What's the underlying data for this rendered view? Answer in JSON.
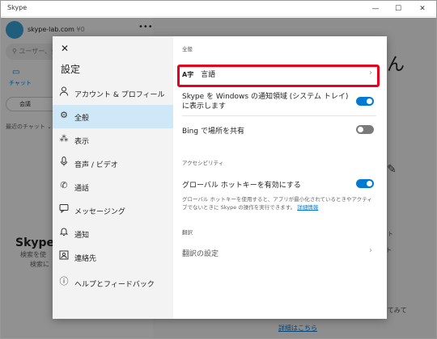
{
  "window": {
    "title": "Skype",
    "minimize": "—",
    "maximize": "☐",
    "close": "✕"
  },
  "background": {
    "avatar_text": "",
    "account": "skype-lab.com",
    "account_suffix": "¥0",
    "more": "•••",
    "search_placeholder": "ユーザー、グル…",
    "chat_label": "チャット",
    "meet_label": "会議",
    "recent_label": "最近のチャット ⌄",
    "big_text": "Skype で",
    "sub1": "検索を使",
    "sub2": "検索に",
    "right_big": "さん",
    "pencil": "✎",
    "r1": "ト",
    "r2": "ト",
    "r3": "試してみて",
    "r4": "詳細はこちら"
  },
  "settings": {
    "close": "✕",
    "title": "設定",
    "nav": [
      {
        "icon": "person-icon",
        "glyph": "⚲",
        "label": "アカウント & プロフィール",
        "selected": false
      },
      {
        "icon": "gear-icon",
        "glyph": "⚙",
        "label": "全般",
        "selected": true
      },
      {
        "icon": "wand-icon",
        "glyph": "✎",
        "label": "表示",
        "selected": false
      },
      {
        "icon": "microphone-icon",
        "glyph": "🎙",
        "label": "音声 / ビデオ",
        "selected": false
      },
      {
        "icon": "phone-icon",
        "glyph": "✆",
        "label": "通話",
        "selected": false
      },
      {
        "icon": "message-icon",
        "glyph": "▭",
        "label": "メッセージング",
        "selected": false
      },
      {
        "icon": "bell-icon",
        "glyph": "♫",
        "label": "通知",
        "selected": false
      },
      {
        "icon": "contacts-icon",
        "glyph": "☺",
        "label": "連絡先",
        "selected": false
      },
      {
        "icon": "info-icon",
        "glyph": "ⓘ",
        "label": "ヘルプとフィードバック",
        "selected": false
      }
    ],
    "general": {
      "section_general": "全般",
      "language_icon": "A字",
      "language_label": "言語",
      "tray_label": "Skype を Windows の通知領域 (システム トレイ) に表示します",
      "tray_on": true,
      "bing_label": "Bing で場所を共有",
      "bing_on": false,
      "section_accessibility": "アクセシビリティ",
      "hotkey_label": "グローバル ホットキーを有効にする",
      "hotkey_on": true,
      "hotkey_desc": "グローバル ホットキーを使用すると、アプリが最小化されているときやアクティブでないときに Skype の操作を実行できます。",
      "hotkey_link": "詳細情報",
      "section_translate": "翻訳",
      "translate_label": "翻訳の設定",
      "chevron": "›"
    }
  }
}
